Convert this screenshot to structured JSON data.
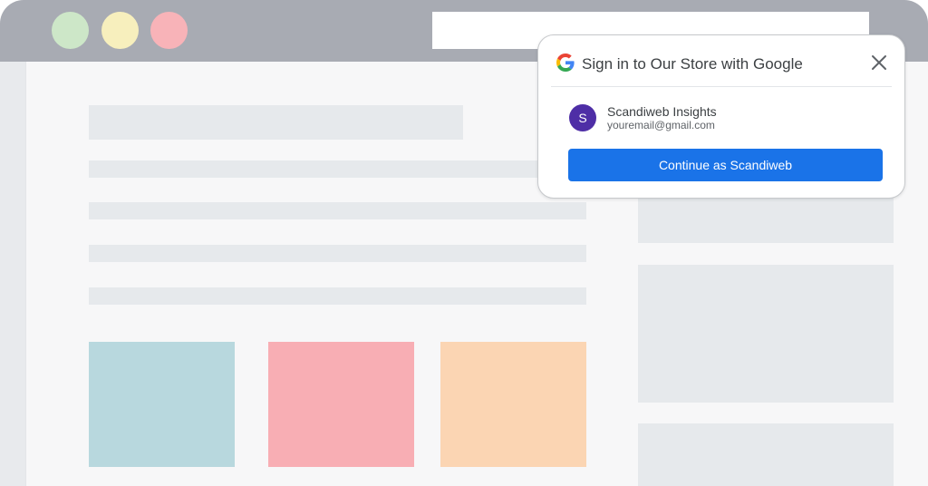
{
  "window": {
    "controls": [
      "green-dot",
      "yellow-dot",
      "red-dot"
    ]
  },
  "popup": {
    "title": "Sign in to Our Store with Google",
    "logo_icon": "google-g-icon",
    "close_icon": "close-icon",
    "account": {
      "avatar_letter": "S",
      "name": "Scandiweb Insights",
      "email": "youremail@gmail.com"
    },
    "continue_label": "Continue as Scandiweb"
  },
  "colors": {
    "frame": "#a8abb3",
    "accent": "#1a73e8",
    "avatar": "#4e2ea6",
    "tile_blue": "#b8d8de",
    "tile_pink": "#f8aeb4",
    "tile_peach": "#fbd5b3"
  }
}
